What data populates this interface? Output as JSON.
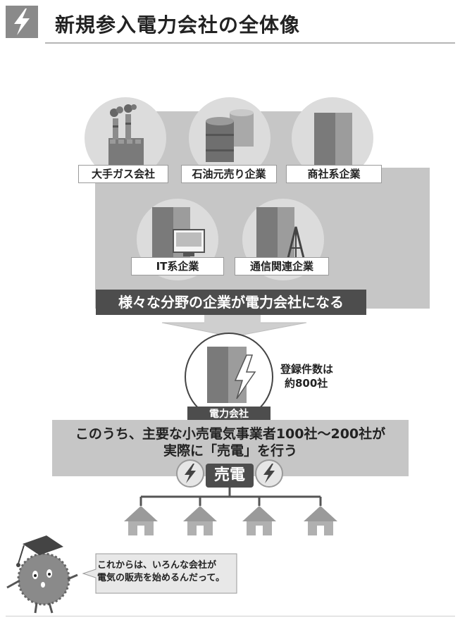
{
  "header": {
    "title": "新規参入電力会社の全体像"
  },
  "companies": [
    {
      "label": "大手ガス会社"
    },
    {
      "label": "石油元売り企業"
    },
    {
      "label": "商社系企業"
    },
    {
      "label": "IT系企業"
    },
    {
      "label": "通信関連企業"
    }
  ],
  "banner_various": "様々な分野の企業が電力会社になる",
  "power_company": {
    "label": "電力会社",
    "registration_line1": "登録件数は",
    "registration_line2": "約800社"
  },
  "retail_box": {
    "line1": "このうち、主要な小売電気事業者100社〜200社が",
    "line2": "実際に「売電」を行う"
  },
  "sale_label": "売電",
  "mascot_bubble": {
    "line1": "これからは、いろんな会社が",
    "line2": "電気の販売を始めるんだって。"
  },
  "colors": {
    "banner": "#4d4d4d",
    "panel": "#c6c6c6",
    "circle": "#dcdcdc"
  }
}
